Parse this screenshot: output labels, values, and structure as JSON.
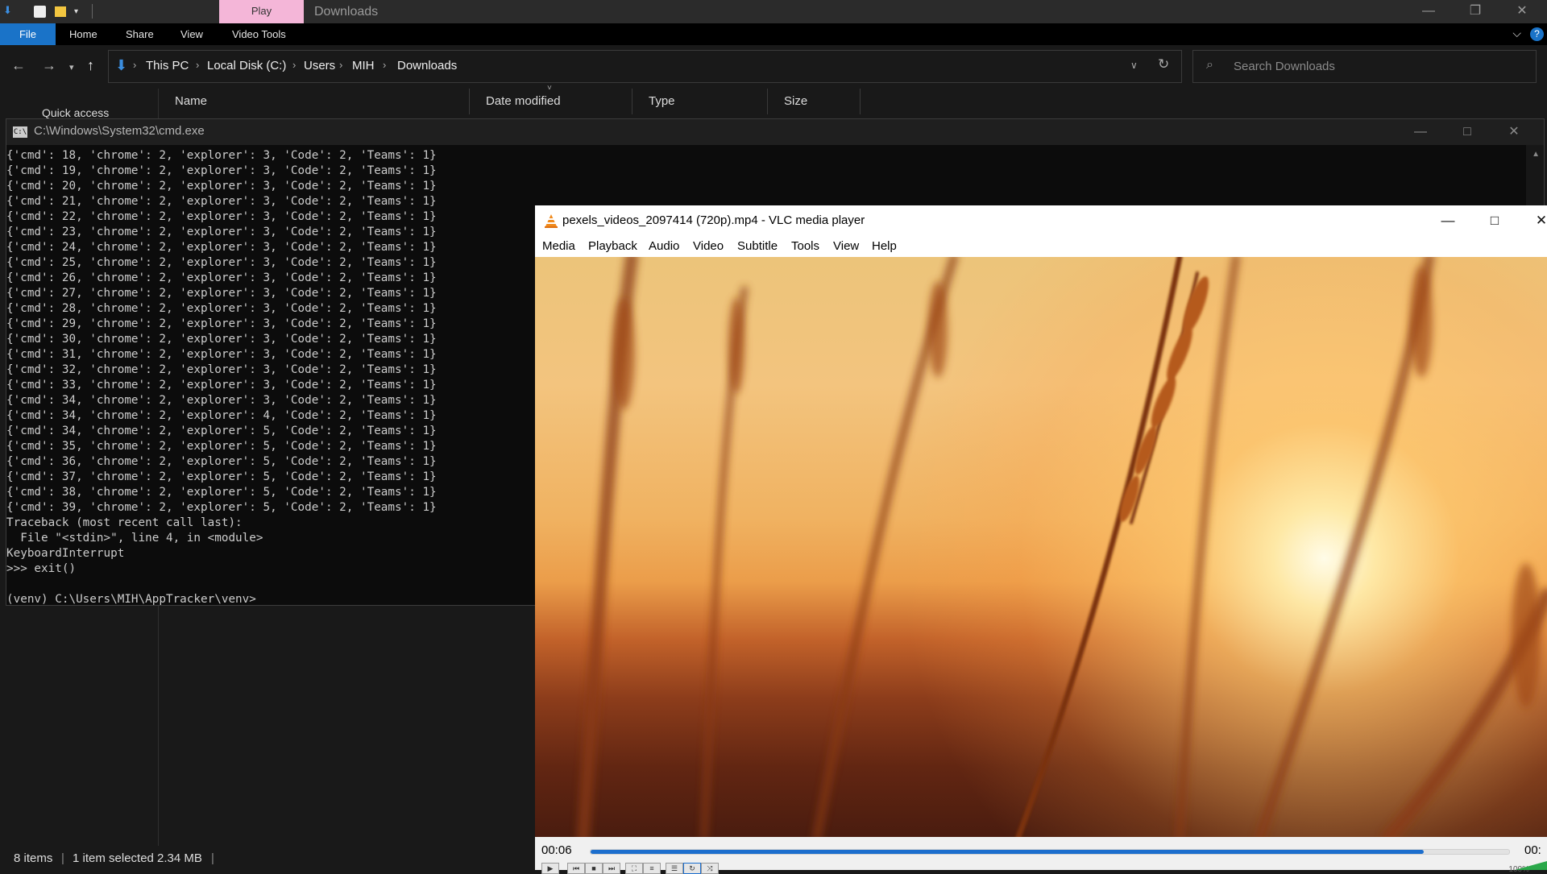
{
  "explorer": {
    "title": "Downloads",
    "context_tab": "Play",
    "ribbon_tabs": [
      "File",
      "Home",
      "Share",
      "View",
      "Video Tools"
    ],
    "breadcrumbs": [
      "This PC",
      "Local Disk (C:)",
      "Users",
      "MIH",
      "Downloads"
    ],
    "search_placeholder": "Search Downloads",
    "columns": [
      "Name",
      "Date modified",
      "Type",
      "Size"
    ],
    "quick_access": "Quick access",
    "status": {
      "items": "8 items",
      "selected": "1 item selected  2.34 MB"
    }
  },
  "cmd": {
    "title": "C:\\Windows\\System32\\cmd.exe",
    "lines": [
      "{'cmd': 18, 'chrome': 2, 'explorer': 3, 'Code': 2, 'Teams': 1}",
      "{'cmd': 19, 'chrome': 2, 'explorer': 3, 'Code': 2, 'Teams': 1}",
      "{'cmd': 20, 'chrome': 2, 'explorer': 3, 'Code': 2, 'Teams': 1}",
      "{'cmd': 21, 'chrome': 2, 'explorer': 3, 'Code': 2, 'Teams': 1}",
      "{'cmd': 22, 'chrome': 2, 'explorer': 3, 'Code': 2, 'Teams': 1}",
      "{'cmd': 23, 'chrome': 2, 'explorer': 3, 'Code': 2, 'Teams': 1}",
      "{'cmd': 24, 'chrome': 2, 'explorer': 3, 'Code': 2, 'Teams': 1}",
      "{'cmd': 25, 'chrome': 2, 'explorer': 3, 'Code': 2, 'Teams': 1}",
      "{'cmd': 26, 'chrome': 2, 'explorer': 3, 'Code': 2, 'Teams': 1}",
      "{'cmd': 27, 'chrome': 2, 'explorer': 3, 'Code': 2, 'Teams': 1}",
      "{'cmd': 28, 'chrome': 2, 'explorer': 3, 'Code': 2, 'Teams': 1}",
      "{'cmd': 29, 'chrome': 2, 'explorer': 3, 'Code': 2, 'Teams': 1}",
      "{'cmd': 30, 'chrome': 2, 'explorer': 3, 'Code': 2, 'Teams': 1}",
      "{'cmd': 31, 'chrome': 2, 'explorer': 3, 'Code': 2, 'Teams': 1}",
      "{'cmd': 32, 'chrome': 2, 'explorer': 3, 'Code': 2, 'Teams': 1}",
      "{'cmd': 33, 'chrome': 2, 'explorer': 3, 'Code': 2, 'Teams': 1}",
      "{'cmd': 34, 'chrome': 2, 'explorer': 3, 'Code': 2, 'Teams': 1}",
      "{'cmd': 34, 'chrome': 2, 'explorer': 4, 'Code': 2, 'Teams': 1}",
      "{'cmd': 34, 'chrome': 2, 'explorer': 5, 'Code': 2, 'Teams': 1}",
      "{'cmd': 35, 'chrome': 2, 'explorer': 5, 'Code': 2, 'Teams': 1}",
      "{'cmd': 36, 'chrome': 2, 'explorer': 5, 'Code': 2, 'Teams': 1}",
      "{'cmd': 37, 'chrome': 2, 'explorer': 5, 'Code': 2, 'Teams': 1}",
      "{'cmd': 38, 'chrome': 2, 'explorer': 5, 'Code': 2, 'Teams': 1}",
      "{'cmd': 39, 'chrome': 2, 'explorer': 5, 'Code': 2, 'Teams': 1}",
      "Traceback (most recent call last):",
      "  File \"<stdin>\", line 4, in <module>",
      "KeyboardInterrupt",
      ">>> exit()",
      "",
      "(venv) C:\\Users\\MIH\\AppTracker\\venv>"
    ]
  },
  "vlc": {
    "title": "pexels_videos_2097414 (720p).mp4 - VLC media player",
    "menu": [
      "Media",
      "Playback",
      "Audio",
      "Video",
      "Subtitle",
      "Tools",
      "View",
      "Help"
    ],
    "elapsed": "00:06",
    "remaining": "00:",
    "progress": 0.907,
    "volume": "100%",
    "accent": "#1c6ecd"
  },
  "colors": {
    "file_tab": "#1a73c8",
    "play_tab": "#f4b6d8",
    "console_bg": "#0c0c0c"
  }
}
